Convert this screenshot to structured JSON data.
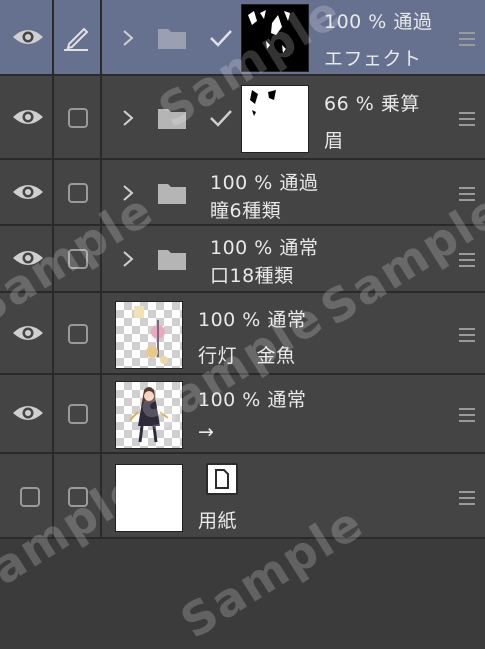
{
  "layers": [
    {
      "opacity": "100 %",
      "blend": "通過",
      "name": "エフェクト"
    },
    {
      "opacity": "66 %",
      "blend": "乗算",
      "name": "眉"
    },
    {
      "opacity": "100 %",
      "blend": "通過",
      "name": "瞳6種類"
    },
    {
      "opacity": "100 %",
      "blend": "通常",
      "name": "口18種類"
    },
    {
      "opacity": "100 %",
      "blend": "通常",
      "name": "行灯　金魚"
    },
    {
      "opacity": "100 %",
      "blend": "通常",
      "name": "→"
    },
    {
      "name": "用紙"
    }
  ],
  "watermark": "Sample",
  "colors": {
    "selected_row": "#66718f",
    "row": "#444444",
    "border": "#2a2a2a"
  },
  "icons": [
    "eye-icon",
    "pen-icon",
    "checkbox",
    "chevron-right-icon",
    "folder-icon",
    "checkmark-icon",
    "hamburger-icon",
    "paper-icon"
  ]
}
